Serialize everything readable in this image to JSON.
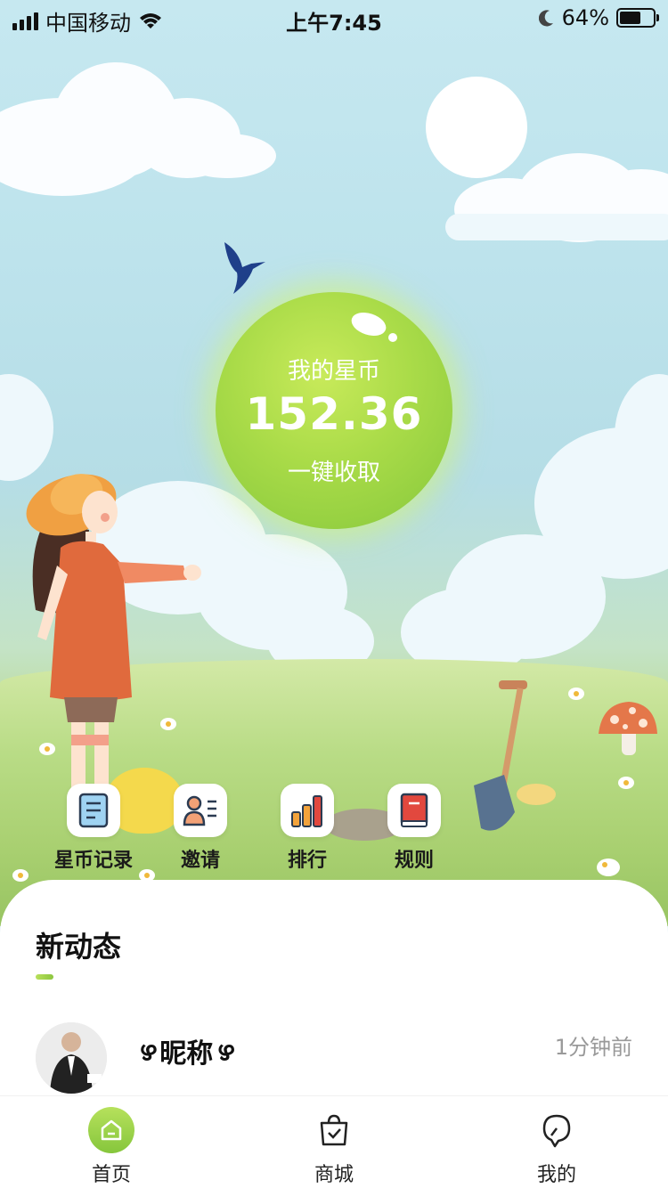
{
  "status_bar": {
    "carrier": "中国移动",
    "time": "上午7:45",
    "battery_percent": "64%",
    "battery_level": 0.64
  },
  "coin": {
    "label": "我的星币",
    "value": "152.36",
    "action": "一键收取"
  },
  "shortcuts": [
    {
      "label": "星币记录",
      "icon": "record-icon"
    },
    {
      "label": "邀请",
      "icon": "invite-icon"
    },
    {
      "label": "排行",
      "icon": "ranking-icon"
    },
    {
      "label": "规则",
      "icon": "rules-book-icon"
    }
  ],
  "feed": {
    "title": "新动态",
    "items": [
      {
        "nickname": "昵称",
        "time": "1分钟前"
      }
    ]
  },
  "tabbar": {
    "items": [
      {
        "label": "首页",
        "icon": "home-icon",
        "active": true
      },
      {
        "label": "商城",
        "icon": "shopping-bag-icon",
        "active": false
      },
      {
        "label": "我的",
        "icon": "profile-icon",
        "active": false
      }
    ]
  },
  "colors": {
    "accent": "#8cc63f",
    "sky": "#c6e8f0"
  }
}
